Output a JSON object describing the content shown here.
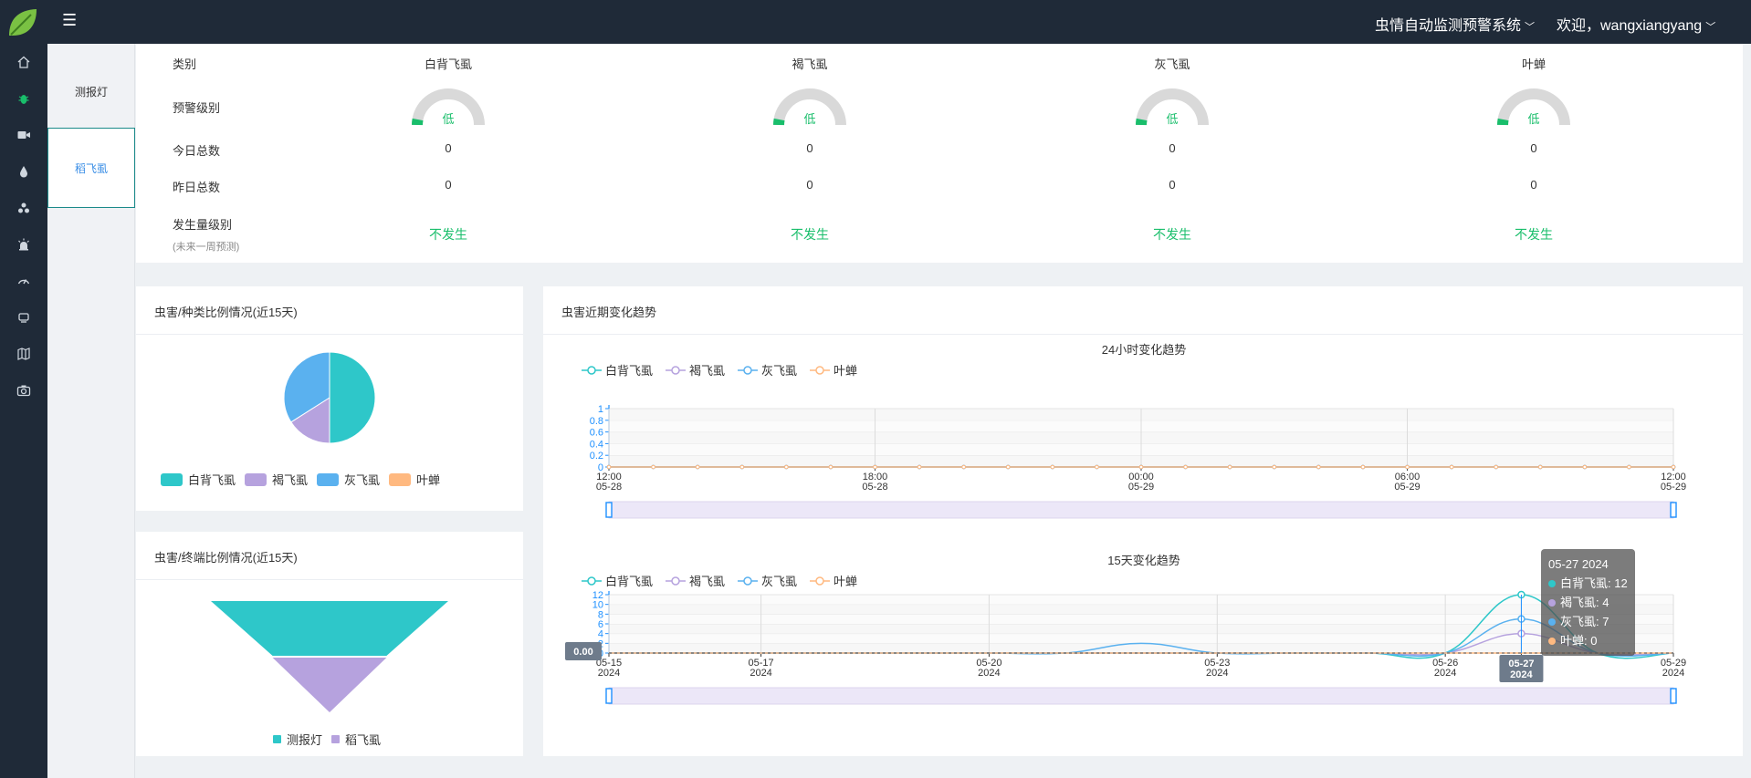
{
  "header": {
    "system_name": "虫情自动监测预警系统",
    "welcome": "欢迎，wangxiangyang",
    "menu_icon": "hamburger-icon",
    "brand_color": "#1f2a38"
  },
  "rail": {
    "items": [
      {
        "icon": "home-icon"
      },
      {
        "icon": "bug-icon",
        "active": true
      },
      {
        "icon": "video-camera-icon"
      },
      {
        "icon": "water-drop-icon"
      },
      {
        "icon": "cluster-icon"
      },
      {
        "icon": "alarm-light-icon"
      },
      {
        "icon": "speedometer-icon"
      },
      {
        "icon": "satellite-icon"
      },
      {
        "icon": "map-book-icon"
      },
      {
        "icon": "camera-icon"
      }
    ]
  },
  "submenu": {
    "items": [
      {
        "label": "测报灯"
      },
      {
        "label": "稻飞虱",
        "active": true
      }
    ]
  },
  "summary": {
    "row_labels": {
      "category": "类别",
      "warning_level": "预警级别",
      "today_total": "今日总数",
      "yesterday_total": "昨日总数",
      "occurrence_level": "发生量级别",
      "occurrence_note": "(未来一周预测)"
    },
    "columns": [
      {
        "name": "白背飞虱",
        "level": "低",
        "today": "0",
        "yesterday": "0",
        "occurrence": "不发生"
      },
      {
        "name": "褐飞虱",
        "level": "低",
        "today": "0",
        "yesterday": "0",
        "occurrence": "不发生"
      },
      {
        "name": "灰飞虱",
        "level": "低",
        "today": "0",
        "yesterday": "0",
        "occurrence": "不发生"
      },
      {
        "name": "叶蝉",
        "level": "低",
        "today": "0",
        "yesterday": "0",
        "occurrence": "不发生"
      }
    ],
    "green": "#19be6b",
    "gauge_track": "#d9d9d9"
  },
  "pie_card": {
    "title": "虫害/种类比例情况(近15天)",
    "legend": [
      {
        "label": "白背飞虱",
        "color": "#2ec7c9"
      },
      {
        "label": "褐飞虱",
        "color": "#b6a2de"
      },
      {
        "label": "灰飞虱",
        "color": "#5ab1ef"
      },
      {
        "label": "叶蝉",
        "color": "#ffb980"
      }
    ]
  },
  "funnel_card": {
    "title": "虫害/终端比例情况(近15天)",
    "legend": [
      {
        "label": "测报灯",
        "color": "#2ec7c9"
      },
      {
        "label": "稻飞虱",
        "color": "#b6a2de"
      }
    ]
  },
  "trend_card": {
    "title": "虫害近期变化趋势",
    "legend": [
      {
        "label": "白背飞虱",
        "color": "#2ec7c9"
      },
      {
        "label": "褐飞虱",
        "color": "#b6a2de"
      },
      {
        "label": "灰飞虱",
        "color": "#5ab1ef"
      },
      {
        "label": "叶蝉",
        "color": "#ffb980"
      }
    ],
    "tooltip": {
      "date": "05-27 2024",
      "rows": [
        {
          "label": "白背飞虱: 12",
          "color": "#2ec7c9"
        },
        {
          "label": "褐飞虱: 4",
          "color": "#b6a2de"
        },
        {
          "label": "灰飞虱: 7",
          "color": "#5ab1ef"
        },
        {
          "label": "叶蝉: 0",
          "color": "#ffb980"
        }
      ]
    },
    "axis_pointer_value": "0.00",
    "axis_pointer_date": [
      "05-27",
      "2024"
    ]
  },
  "chart_data": [
    {
      "type": "pie",
      "title": "虫害/种类比例情况(近15天)",
      "categories": [
        "白背飞虱",
        "褐飞虱",
        "灰飞虱",
        "叶蝉"
      ],
      "values": [
        50,
        16,
        34,
        0
      ],
      "colors": [
        "#2ec7c9",
        "#b6a2de",
        "#5ab1ef",
        "#ffb980"
      ]
    },
    {
      "type": "funnel",
      "title": "虫害/终端比例情况(近15天)",
      "categories": [
        "测报灯",
        "稻飞虱"
      ],
      "values": [
        100,
        48
      ],
      "colors": [
        "#2ec7c9",
        "#b6a2de"
      ]
    },
    {
      "type": "line",
      "title": "24小时变化趋势",
      "x_ticks": [
        [
          "12:00",
          "05-28"
        ],
        [
          "18:00",
          "05-28"
        ],
        [
          "00:00",
          "05-29"
        ],
        [
          "06:00",
          "05-29"
        ],
        [
          "12:00",
          "05-29"
        ]
      ],
      "y_ticks": [
        "0",
        "0.2",
        "0.4",
        "0.6",
        "0.8",
        "1"
      ],
      "ylim": [
        0,
        1
      ],
      "points": 25,
      "series": [
        {
          "name": "白背飞虱",
          "values": [
            0,
            0,
            0,
            0,
            0,
            0,
            0,
            0,
            0,
            0,
            0,
            0,
            0,
            0,
            0,
            0,
            0,
            0,
            0,
            0,
            0,
            0,
            0,
            0,
            0
          ],
          "color": "#2ec7c9"
        },
        {
          "name": "褐飞虱",
          "values": [
            0,
            0,
            0,
            0,
            0,
            0,
            0,
            0,
            0,
            0,
            0,
            0,
            0,
            0,
            0,
            0,
            0,
            0,
            0,
            0,
            0,
            0,
            0,
            0,
            0
          ],
          "color": "#b6a2de"
        },
        {
          "name": "灰飞虱",
          "values": [
            0,
            0,
            0,
            0,
            0,
            0,
            0,
            0,
            0,
            0,
            0,
            0,
            0,
            0,
            0,
            0,
            0,
            0,
            0,
            0,
            0,
            0,
            0,
            0,
            0
          ],
          "color": "#5ab1ef"
        },
        {
          "name": "叶蝉",
          "values": [
            0,
            0,
            0,
            0,
            0,
            0,
            0,
            0,
            0,
            0,
            0,
            0,
            0,
            0,
            0,
            0,
            0,
            0,
            0,
            0,
            0,
            0,
            0,
            0,
            0
          ],
          "color": "#ffb980"
        }
      ],
      "grid": true
    },
    {
      "type": "line",
      "title": "15天变化趋势",
      "x": [
        "05-15",
        "05-16",
        "05-17",
        "05-18",
        "05-19",
        "05-20",
        "05-21",
        "05-22",
        "05-23",
        "05-24",
        "05-25",
        "05-26",
        "05-27",
        "05-28",
        "05-29"
      ],
      "x_ticks": [
        [
          "05-15",
          "2024"
        ],
        [
          "05-17",
          "2024"
        ],
        [
          "05-20",
          "2024"
        ],
        [
          "05-23",
          "2024"
        ],
        [
          "05-26",
          "2024"
        ],
        [
          "05-27",
          "2024"
        ],
        [
          "05-29",
          "2024"
        ]
      ],
      "y_ticks": [
        "0",
        "2",
        "4",
        "6",
        "8",
        "10",
        "12"
      ],
      "ylim": [
        0,
        12
      ],
      "series": [
        {
          "name": "白背飞虱",
          "values": [
            0,
            0,
            0,
            0,
            0,
            0,
            0,
            0,
            0,
            0,
            0,
            0,
            12,
            0,
            0
          ],
          "color": "#2ec7c9"
        },
        {
          "name": "褐飞虱",
          "values": [
            0,
            0,
            0,
            0,
            0,
            0,
            0,
            0,
            0,
            0,
            0,
            0,
            4,
            0,
            0
          ],
          "color": "#b6a2de"
        },
        {
          "name": "灰飞虱",
          "values": [
            0,
            0,
            0,
            0,
            0,
            0,
            0,
            2,
            0,
            0,
            0,
            0,
            7,
            0,
            0
          ],
          "color": "#5ab1ef"
        },
        {
          "name": "叶蝉",
          "values": [
            0,
            0,
            0,
            0,
            0,
            0,
            0,
            0,
            0,
            0,
            0,
            0,
            0,
            0,
            0
          ],
          "color": "#ffb980"
        }
      ],
      "grid": true
    }
  ]
}
